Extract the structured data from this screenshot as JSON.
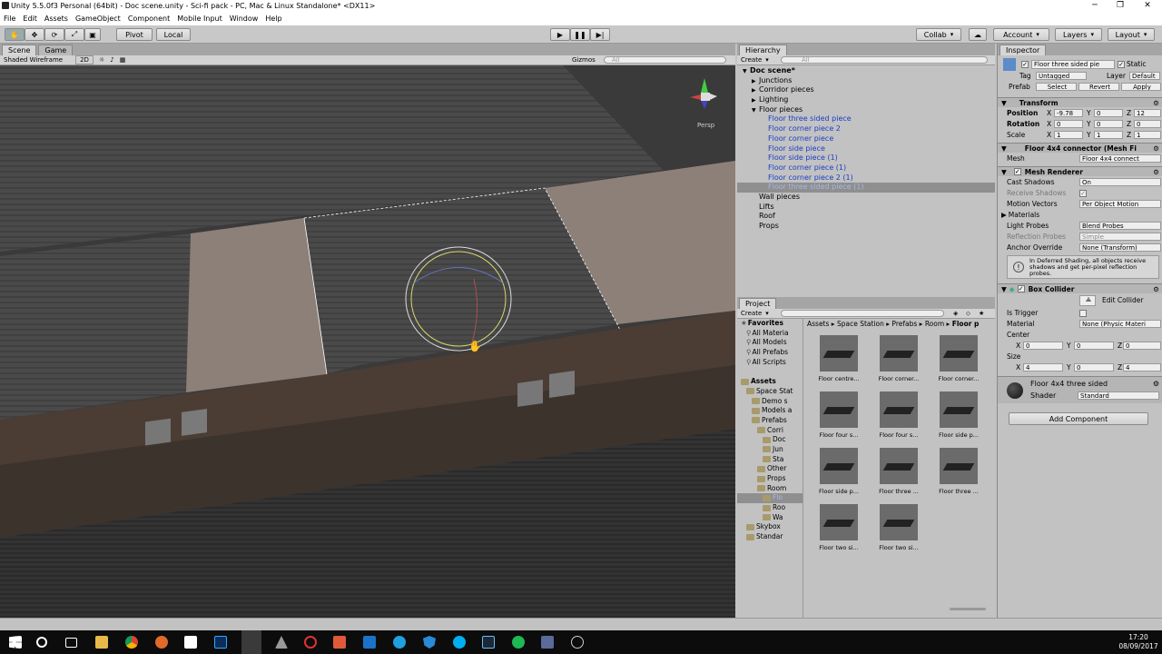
{
  "window": {
    "title": "Unity 5.5.0f3 Personal (64bit) - Doc scene.unity - Sci-fi pack - PC, Mac & Linux Standalone* <DX11>"
  },
  "menu": [
    "File",
    "Edit",
    "Assets",
    "GameObject",
    "Component",
    "Mobile Input",
    "Window",
    "Help"
  ],
  "toolbar": {
    "pivot": "Pivot",
    "local": "Local",
    "collab": "Collab",
    "account": "Account",
    "layers": "Layers",
    "layout": "Layout"
  },
  "scene": {
    "tab_scene": "Scene",
    "tab_game": "Game",
    "shading": "Shaded Wireframe",
    "mode2d": "2D",
    "gizmos": "Gizmos",
    "search_placeholder": "All",
    "persp": "Persp"
  },
  "hierarchy": {
    "tab": "Hierarchy",
    "create": "Create",
    "search_placeholder": "All",
    "rows": [
      {
        "label": "Doc scene*",
        "indent": 0,
        "arrow": "▼",
        "style": "bold"
      },
      {
        "label": "Junctions",
        "indent": 1,
        "arrow": "▶",
        "style": ""
      },
      {
        "label": "Corridor pieces",
        "indent": 1,
        "arrow": "▶",
        "style": ""
      },
      {
        "label": "Lighting",
        "indent": 1,
        "arrow": "▶",
        "style": ""
      },
      {
        "label": "Floor pieces",
        "indent": 1,
        "arrow": "▼",
        "style": ""
      },
      {
        "label": "Floor three sided piece",
        "indent": 2,
        "arrow": "",
        "style": "blue"
      },
      {
        "label": "Floor corner piece 2",
        "indent": 2,
        "arrow": "",
        "style": "blue"
      },
      {
        "label": "Floor corner piece",
        "indent": 2,
        "arrow": "",
        "style": "blue"
      },
      {
        "label": "Floor side piece",
        "indent": 2,
        "arrow": "",
        "style": "blue"
      },
      {
        "label": "Floor side piece (1)",
        "indent": 2,
        "arrow": "",
        "style": "blue"
      },
      {
        "label": "Floor corner piece (1)",
        "indent": 2,
        "arrow": "",
        "style": "blue"
      },
      {
        "label": "Floor corner piece 2 (1)",
        "indent": 2,
        "arrow": "",
        "style": "blue"
      },
      {
        "label": "Floor three sided piece (1)",
        "indent": 2,
        "arrow": "",
        "style": "sel"
      },
      {
        "label": "Wall pieces",
        "indent": 1,
        "arrow": "",
        "style": ""
      },
      {
        "label": "Lifts",
        "indent": 1,
        "arrow": "",
        "style": ""
      },
      {
        "label": "Roof",
        "indent": 1,
        "arrow": "",
        "style": ""
      },
      {
        "label": "Props",
        "indent": 1,
        "arrow": "",
        "style": ""
      }
    ]
  },
  "project": {
    "tab": "Project",
    "create": "Create",
    "breadcrumb": [
      "Assets",
      "Space Station",
      "Prefabs",
      "Room",
      "Floor p"
    ],
    "tree": [
      {
        "label": "Favorites",
        "indent": 0,
        "icon": "star",
        "bold": true
      },
      {
        "label": "All Materia",
        "indent": 1,
        "icon": "search"
      },
      {
        "label": "All Models",
        "indent": 1,
        "icon": "search"
      },
      {
        "label": "All Prefabs",
        "indent": 1,
        "icon": "search"
      },
      {
        "label": "All Scripts",
        "indent": 1,
        "icon": "search"
      },
      {
        "label": "",
        "indent": 0,
        "icon": ""
      },
      {
        "label": "Assets",
        "indent": 0,
        "icon": "folder",
        "bold": true
      },
      {
        "label": "Space Stat",
        "indent": 1,
        "icon": "folder"
      },
      {
        "label": "Demo s",
        "indent": 2,
        "icon": "folder"
      },
      {
        "label": "Models a",
        "indent": 2,
        "icon": "folder"
      },
      {
        "label": "Prefabs",
        "indent": 2,
        "icon": "folder"
      },
      {
        "label": "Corri",
        "indent": 3,
        "icon": "folder"
      },
      {
        "label": "Doc",
        "indent": 4,
        "icon": "folder"
      },
      {
        "label": "Jun",
        "indent": 4,
        "icon": "folder"
      },
      {
        "label": "Sta",
        "indent": 4,
        "icon": "folder"
      },
      {
        "label": "Other",
        "indent": 3,
        "icon": "folder"
      },
      {
        "label": "Props",
        "indent": 3,
        "icon": "folder"
      },
      {
        "label": "Room",
        "indent": 3,
        "icon": "folder"
      },
      {
        "label": "Flo",
        "indent": 4,
        "icon": "folder",
        "sel": true
      },
      {
        "label": "Roo",
        "indent": 4,
        "icon": "folder"
      },
      {
        "label": "Wa",
        "indent": 4,
        "icon": "folder"
      },
      {
        "label": "Skybox",
        "indent": 1,
        "icon": "folder"
      },
      {
        "label": "Standar",
        "indent": 1,
        "icon": "folder"
      }
    ],
    "assets": [
      "Floor centre...",
      "Floor corner...",
      "Floor corner...",
      "Floor four s...",
      "Floor four s...",
      "Floor side p...",
      "Floor side p...",
      "Floor three ...",
      "Floor three ...",
      "Floor two si...",
      "Floor two si..."
    ]
  },
  "inspector": {
    "tab": "Inspector",
    "object_name": "Floor three sided pie",
    "static": "Static",
    "tag_label": "Tag",
    "tag": "Untagged",
    "layer_label": "Layer",
    "layer": "Default",
    "prefab_label": "Prefab",
    "select": "Select",
    "revert": "Revert",
    "apply": "Apply",
    "transform": {
      "title": "Transform",
      "position": "Position",
      "rotation": "Rotation",
      "scale": "Scale",
      "pos": [
        "-9.78",
        "0",
        "12"
      ],
      "rot": [
        "0",
        "0",
        "0"
      ],
      "scl": [
        "1",
        "1",
        "1"
      ]
    },
    "mesh_filter": {
      "title": "Floor 4x4 connector (Mesh Fi",
      "mesh_label": "Mesh",
      "mesh": "Floor 4x4 connect"
    },
    "mesh_renderer": {
      "title": "Mesh Renderer",
      "cast": "Cast Shadows",
      "cast_val": "On",
      "receive": "Receive Shadows",
      "motion": "Motion Vectors",
      "motion_val": "Per Object Motion",
      "materials": "Materials",
      "light": "Light Probes",
      "light_val": "Blend Probes",
      "reflection": "Reflection Probes",
      "reflection_val": "Simple",
      "anchor": "Anchor Override",
      "anchor_val": "None (Transform)",
      "info": "In Deferred Shading, all objects receive shadows and get per-pixel reflection probes."
    },
    "box_collider": {
      "title": "Box Collider",
      "edit": "Edit Collider",
      "trigger": "Is Trigger",
      "material": "Material",
      "material_val": "None (Physic Materi",
      "center": "Center",
      "center_vals": [
        "0",
        "0",
        "0"
      ],
      "size": "Size",
      "size_vals": [
        "4",
        "0",
        "4"
      ]
    },
    "material": {
      "name": "Floor 4x4 three sided",
      "shader_label": "Shader",
      "shader": "Standard"
    },
    "add_component": "Add Component"
  },
  "clock": {
    "time": "17:20",
    "date": "08/09/2017"
  }
}
